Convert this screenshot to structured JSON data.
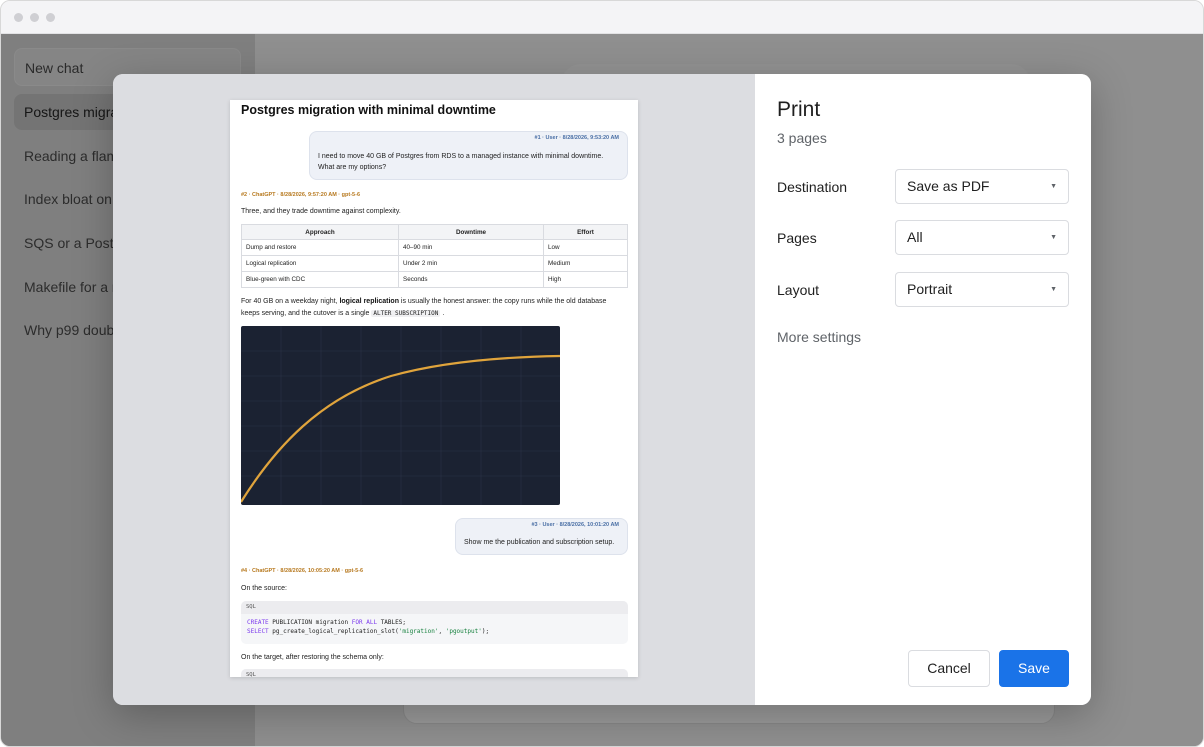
{
  "sidebar": {
    "new_chat": "New chat",
    "items": [
      {
        "label": "Postgres migra"
      },
      {
        "label": "Reading a flam"
      },
      {
        "label": "Index bloat on"
      },
      {
        "label": "SQS or a Postg"
      },
      {
        "label": "Makefile for a r"
      },
      {
        "label": "Why p99 doub"
      }
    ]
  },
  "print_dialog": {
    "title": "Print",
    "pages_count": "3 pages",
    "destination_label": "Destination",
    "destination_value": "Save as PDF",
    "pages_label": "Pages",
    "pages_value": "All",
    "layout_label": "Layout",
    "layout_value": "Portrait",
    "more_settings": "More settings",
    "cancel": "Cancel",
    "save": "Save",
    "accent_color": "#1a73e8"
  },
  "preview": {
    "title": "Postgres migration with minimal downtime",
    "msg1_meta": "#1 · User · 8/28/2026, 9:53:20 AM",
    "msg1_line1": "I need to move 40 GB of Postgres from RDS to a managed instance with minimal downtime.",
    "msg1_line2": "What are my options?",
    "msg2_meta": "#2 · ChatGPT · 8/28/2026, 9:57:20 AM · gpt-5-6",
    "msg2_intro": "Three, and they trade downtime against complexity.",
    "table": {
      "headers": [
        "Approach",
        "Downtime",
        "Effort"
      ],
      "rows": [
        [
          "Dump and restore",
          "40–90 min",
          "Low"
        ],
        [
          "Logical replication",
          "Under 2 min",
          "Medium"
        ],
        [
          "Blue-green with CDC",
          "Seconds",
          "High"
        ]
      ]
    },
    "para_a": "For 40 GB on a weekday night, ",
    "para_bold": "logical replication",
    "para_b": " is usually the honest answer: the copy runs while the old database",
    "para_c": "keeps serving, and the cutover is a single ",
    "para_code": "ALTER SUBSCRIPTION",
    "para_d": " .",
    "msg3_meta": "#3 · User · 8/28/2026, 10:01:20 AM",
    "msg3_text": "Show me the publication and subscription setup.",
    "msg4_meta": "#4 · ChatGPT · 8/28/2026, 10:05:20 AM · gpt-5-6",
    "msg4_intro": "On the source:",
    "code1_lang": "SQL",
    "code1_l1_kw1": "CREATE",
    "code1_l1_a": " PUBLICATION migration ",
    "code1_l1_kw2": "FOR ALL",
    "code1_l1_b": " TABLES;",
    "code1_l2_kw": "SELECT",
    "code1_l2_a": " pg_create_logical_replication_slot(",
    "code1_l2_s1": "'migration'",
    "code1_l2_b": ", ",
    "code1_l2_s2": "'pgoutput'",
    "code1_l2_c": ");",
    "msg4_after": "On the target, after restoring the schema only:",
    "code2_lang": "SQL"
  }
}
